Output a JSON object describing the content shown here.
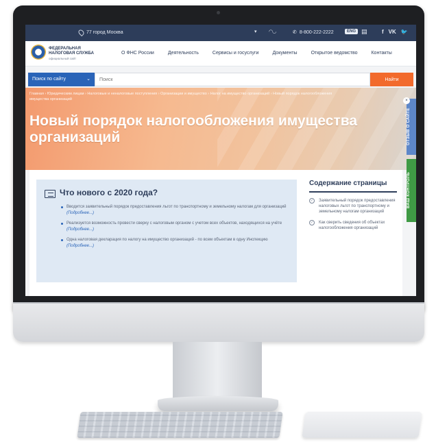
{
  "topbar": {
    "location": "77 город Москва",
    "phone": "8-800-222-2222",
    "lang": "ENG",
    "social": [
      "f",
      "VK",
      "🐦"
    ]
  },
  "header": {
    "logo_line1": "ФЕДЕРАЛЬНАЯ",
    "logo_line2": "НАЛОГОВАЯ СЛУЖБА",
    "logo_sub": "официальный сайт",
    "nav": [
      "О ФНС России",
      "Деятельность",
      "Сервисы и госуслуги",
      "Документы",
      "Открытое ведомство",
      "Контакты"
    ]
  },
  "search": {
    "scope": "Поиск по сайту",
    "placeholder": "Поиск",
    "button": "Найти"
  },
  "hero": {
    "breadcrumbs": "Главная › Юридическим лицам › Налоговые и неналоговые поступления › Организации и имущество › Налог на имущество организаций › Новый порядок налогообложения имущества организаций",
    "title": "Новый порядок налогообложения имущества организаций"
  },
  "side_tabs": {
    "feedback": "ОТЗЫВ О САЙТЕ",
    "control": "ВАШ КОНТРОЛЬ"
  },
  "news": {
    "title": "Что нового с 2020 года?",
    "items": [
      {
        "text": "Вводится заявительный порядок предоставления льгот по транспортному и земельному налогам для организаций",
        "more": "(Подробнее...)"
      },
      {
        "text": "Реализуется возможность провести сверку с налоговым органом с учетом всех объектов, находящихся на учёте",
        "more": "(Подробнее...)"
      },
      {
        "text": "Одна налоговая декларация по налогу на имущество организаций - по всем объектам в одну Инспекцию",
        "more": "(Подробнее...)"
      }
    ]
  },
  "toc": {
    "title": "Содержание страницы",
    "items": [
      "Заявительный порядок предоставления налоговых льгот по транспортному и земельному налогам организаций",
      "Как сверить сведения об объектах налогообложения организаций"
    ]
  },
  "colors": {
    "topbar": "#2d3d5a",
    "accent_blue": "#2a64b8",
    "search_button": "#f26a2c",
    "control_tab": "#3f9a45"
  }
}
